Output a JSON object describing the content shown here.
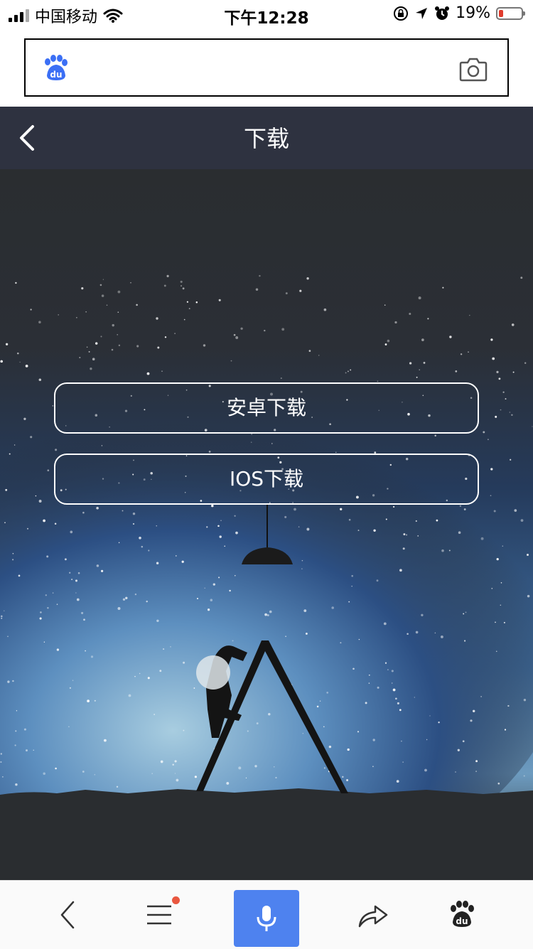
{
  "status_bar": {
    "carrier": "中国移动",
    "time": "下午12:28",
    "battery": "19%",
    "battery_level": 0.19
  },
  "search": {
    "logo_icon": "baidu-paw-icon",
    "camera_icon": "camera-icon"
  },
  "header": {
    "title": "下载",
    "back_icon": "chevron-left-icon"
  },
  "main": {
    "buttons": [
      {
        "label": "安卓下载"
      },
      {
        "label": "IOS下载"
      }
    ]
  },
  "toolbar": {
    "items": [
      {
        "icon": "chevron-left-icon"
      },
      {
        "icon": "menu-icon",
        "has_notification_dot": true
      },
      {
        "icon": "microphone-icon"
      },
      {
        "icon": "share-icon"
      },
      {
        "icon": "baidu-paw-icon"
      }
    ]
  },
  "colors": {
    "nav_bg": "#2e3240",
    "voice_button": "#4e82ef",
    "baidu_blue": "#3b6ff5",
    "notification_dot": "#e9573f",
    "battery_low": "#e03b2c"
  }
}
